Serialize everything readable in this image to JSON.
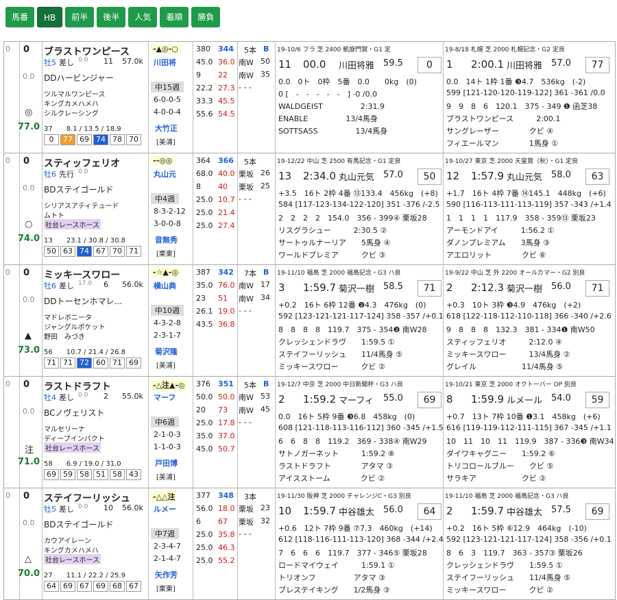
{
  "toolbar": [
    "馬番",
    "HB",
    "前半",
    "後半",
    "人気",
    "着順",
    "勝負"
  ],
  "horses": [
    {
      "no": "0",
      "pop": "0",
      "name": "ブラストワンピース",
      "sex": "牡5",
      "style": "差し",
      "style_sub": "0.0",
      "w": "11",
      "win": "57.0k",
      "odds": "0.0",
      "sire": "DDハービンジャー",
      "dam": "ツルマルワンピース",
      "bms": "キングカメハメハ",
      "owner": "シルクレーシング",
      "owner_tag": false,
      "mark": "◎",
      "score": "77.0",
      "stats": "37　　8.1 / 13.5 / 18.9",
      "marks": "-▲◎-○",
      "jockey": "川田将",
      "weeks": "中15週",
      "rec1": "6-0-0-5",
      "rec2": "4-0-0-4",
      "trainer": "大竹正",
      "loc": "[美浦]",
      "sp": [
        "380",
        "344",
        "45.0",
        "36.0",
        "9",
        "22",
        "22.2",
        "27.3",
        "33.3",
        "45.5",
        "55.6",
        "54.5"
      ],
      "cnt": "5本",
      "grade": "B",
      "cs": [
        [
          "南W",
          "50"
        ],
        [
          "南W",
          "35"
        ],
        [
          "- - -",
          ""
        ]
      ],
      "boxes": [
        "0",
        "77",
        "69",
        "74",
        "78",
        "70"
      ],
      "hl": [
        1,
        3
      ],
      "r1": {
        "hd": "19-10/6 フラ 芝 2400 凱旋門賞・G1 定",
        "rank": "11",
        "time": "00.0",
        "jockey": "川田将雅",
        "wt": "59.5",
        "num": "0",
        "lines": [
          "0.0　0ト　0枠　5番　0.0　　0kg　(0)",
          "0 [　-　-　-　-　-　] -0 /0.0",
          "WALDGEIST　　　　　2:31.9",
          "ENABLE　　　　　13/4馬身",
          "SOTTSASS　　　　　13/4馬身"
        ]
      },
      "r2": {
        "hd": "19-8/18 札幌 芝 2000 札幌記念・G2 定良",
        "rank": "1",
        "time": "2:00.1",
        "jockey": "川田将雅",
        "wt": "57.0",
        "num": "77",
        "lines": [
          "0.0　14ト 1枠 1番 ❸4.7　536kg　(-2)",
          "599 [121-120-120-119-122] 361 -361 /0.0",
          "9　9　8　6　120.1　375 - 349 ❶ 函芝38",
          "ブラストワンピース　　　2:00.1",
          "サングレーザー　　　　クビ ④",
          "フィエールマン　　　　1馬身 ①"
        ]
      }
    },
    {
      "no": "0",
      "pop": "0",
      "name": "スティッフェリオ",
      "sex": "牡6",
      "style": "先行",
      "style_sub": "0.0",
      "w": "",
      "win": "",
      "odds": "0.0",
      "sire": "BDステイゴールド",
      "dam": "シリアスアティテュード",
      "bms": "ムトト",
      "owner": "社台レースホース",
      "owner_tag": true,
      "mark": "○",
      "score": "74.0",
      "stats": "13　　23.1 / 30.8 / 30.8",
      "marks": "--◎◎",
      "jockey": "丸山元",
      "weeks": "中4週",
      "rec1": "8-3-2-12",
      "rec2": "3-0-0-8",
      "trainer": "音無秀",
      "loc": "[栗東]",
      "sp": [
        "364",
        "366",
        "68.0",
        "40.0",
        "8",
        "40",
        "25.0",
        "10.7",
        "25.0",
        "21.4",
        "25.0",
        "27.4"
      ],
      "cnt": "5本",
      "grade": "",
      "cs": [
        [
          "栗坂",
          "26"
        ],
        [
          "栗坂",
          "25"
        ],
        [
          "- - -",
          ""
        ]
      ],
      "boxes": [
        "50",
        "63",
        "74",
        "67",
        "70",
        "71"
      ],
      "hl": [
        2
      ],
      "r1": {
        "hd": "19-12/22 中山 芝 2500 有馬記念・G1 定良",
        "rank": "13",
        "time": "2:34.0",
        "jockey": "丸山元気",
        "wt": "57.0",
        "num": "50",
        "lines": [
          "+3.5　16ト 2枠 4番 ⑬133.4　456kg　(+8)",
          "584 [117-123-134-122-120] 351 -376 /-2.5",
          "2　2　2　2　154.0　356 - 399④ 栗坂28",
          "リスグラシュー　　　2:30.5 ②",
          "サートゥルナーリア　　5馬身 ④",
          "ワールドプレミア　　　クビ ③"
        ]
      },
      "r2": {
        "hd": "19-10/27 東京 芝 2000 天皇賞（秋）・G1 定良",
        "rank": "12",
        "time": "1:57.9",
        "jockey": "丸山元気",
        "wt": "58.0",
        "num": "63",
        "lines": [
          "+1.7　16ト 4枠 7番 ⑭145.1　448kg　(+6)",
          "590 [116-113-111-113-119] 357 -343 /+1.4",
          "1　1　1　1　117.9　358 - 359⑬ 栗坂23",
          "アーモンドアイ　　　1:56.2 ①",
          "ダノンプレミアム　　3馬身 ③",
          "アエロリット　　　　クビ ⑥"
        ]
      }
    },
    {
      "no": "0",
      "pop": "0",
      "name": "ミッキースワロー",
      "sex": "牡6",
      "style": "差し",
      "style_sub": "17.0",
      "w": "6",
      "win": "56.0k",
      "odds": "0.0",
      "sire": "DDトーセンホマレ…",
      "dam": "マドレボニータ",
      "bms": "ジャングルポケット",
      "owner": "野田　みづき",
      "owner_tag": false,
      "mark": "▲",
      "score": "73.0",
      "stats": "56　　10.7 / 21.4 / 26.8",
      "marks": "-☆▲-◎",
      "jockey": "横山典",
      "weeks": "中10週",
      "rec1": "4-3-2-8",
      "rec2": "2-3-1-7",
      "trainer": "菊沢隆",
      "loc": "[美浦]",
      "sp": [
        "387",
        "342",
        "35.0",
        "76.0",
        "23",
        "51",
        "26.1",
        "19.0",
        "43.5",
        "36.8",
        "",
        ""
      ],
      "cnt": "7本",
      "grade": "B",
      "cs": [
        [
          "南W",
          "17"
        ],
        [
          "南W",
          "34"
        ],
        [
          "- - -",
          ""
        ]
      ],
      "boxes": [
        "71",
        "71",
        "72",
        "60",
        "71",
        "69"
      ],
      "hl": [
        2
      ],
      "r1": {
        "hd": "19-11/10 福島 芝 2000 福島記念・G3 ハ良",
        "rank": "3",
        "time": "1:59.7",
        "jockey": "菊沢一樹",
        "wt": "58.5",
        "num": "71",
        "lines": [
          "+0.2　16ト 6枠 12番 ❷4.3　476kg　(0)",
          "592 [123-121-121-117-124] 358 -357 /+0.1",
          "8　8　8　8　119.7　375 - 354❷ 南W28",
          "クレッシェンドラヴ　　1:59.5 ①",
          "ステイフーリッシュ　　11/4馬身 ⑤",
          "ミッキースワロー　　　クビ ②"
        ]
      },
      "r2": {
        "hd": "19-9/22 中山 芝 外 2200 オールカマー・G2 別良",
        "rank": "2",
        "time": "2:12.3",
        "jockey": "菊沢一樹",
        "wt": "56.0",
        "num": "71",
        "lines": [
          "+0.3　10ト 3枠 ❸4.9　476kg　(+2)",
          "618 [122-118-112-110-118] 366 -340 /+2.6",
          "9　8　8　8　132.3　381 - 334❶ 南W50",
          "スティッフェリオ　　　2:12.0 ④",
          "ミッキースワロー　　　13/4馬身 ②",
          "グレイル　　　　　　11/4馬身 ⑤"
        ]
      }
    },
    {
      "no": "0",
      "pop": "0",
      "name": "ラストドラフト",
      "sex": "牡4",
      "style": "差し",
      "style_sub": "0.0",
      "w": "2",
      "win": "55.0k",
      "odds": "0.0",
      "sire": "BCノヴェリスト",
      "dam": "マルセリーナ",
      "bms": "ディープインパクト",
      "owner": "社台レースホース",
      "owner_tag": true,
      "mark": "注",
      "score": "71.0",
      "stats": "58　　6.9 / 19.0 / 31.0",
      "marks": "-△注▲-◎",
      "jockey": "マーフ",
      "weeks": "中6週",
      "rec1": "2-1-0-3",
      "rec2": "1-1-0-3",
      "trainer": "戸田博",
      "loc": "[美浦]",
      "sp": [
        "376",
        "351",
        "50.0",
        "50.0",
        "20",
        "73",
        "25.0",
        "17.8",
        "35.0",
        "37.0",
        "45.0",
        "50.7"
      ],
      "cnt": "5本",
      "grade": "B",
      "cs": [
        [
          "南W",
          "53"
        ],
        [
          "南W",
          "45"
        ],
        [
          "- - -",
          ""
        ]
      ],
      "boxes": [
        "69",
        "59",
        "58",
        "51",
        "58",
        "43"
      ],
      "hl": [],
      "r1": {
        "hd": "19-12/7 中京 芝 2000 中日新聞杯・G3 ハ良",
        "rank": "2",
        "time": "1:59.2",
        "jockey": "マーフィ",
        "wt": "55.0",
        "num": "69",
        "lines": [
          "0.0　16ト 5枠 9番 ❸6.8　458kg　(0)",
          "608 [121-118-113-116-112] 360 -345 /+1.5",
          "6　6　8　8　119.2　369 - 338④ 南W29",
          "サトノガーネット　　　1:59.2 ⑧",
          "ラストドラフト　　　　アタマ ③",
          "アイスストーム　　　　クビ ②"
        ]
      },
      "r2": {
        "hd": "19-10/21 東京 芝 2000 オクトーバー OP 別良",
        "rank": "8",
        "time": "1:59.9",
        "jockey": "ルメール",
        "wt": "54.0",
        "num": "59",
        "lines": [
          "+0.7　13ト 7枠 10番 ❶3.1　458kg　(+6)",
          "616 [119-119-112-111-115] 367 -345 /+1.1",
          "10　11　10　11　119.9　387 - 336❸ 南W34",
          "ダイワキャグニー　　1:59.2 ⑥",
          "トリコロールブルー　　クビ ⑤",
          "サラキア　　　　　　クビ ②"
        ]
      }
    },
    {
      "no": "0",
      "pop": "0",
      "name": "ステイフーリッシュ",
      "sex": "牡5",
      "style": "差し",
      "style_sub": "0.0",
      "w": "10",
      "win": "56.0k",
      "odds": "0.0",
      "sire": "BDステイゴールド",
      "dam": "カウアイレーン",
      "bms": "キングカメハメハ",
      "owner": "社台レースホース",
      "owner_tag": true,
      "mark": "△",
      "score": "70.0",
      "stats": "27　　11.1 / 22.2 / 25.9",
      "marks": "-△△注",
      "jockey": "ルメー",
      "weeks": "中7週",
      "rec1": "2-3-4-7",
      "rec2": "2-1-4-7",
      "trainer": "矢作芳",
      "loc": "[栗東]",
      "sp": [
        "377",
        "348",
        "56.0",
        "18.0",
        "6",
        "67",
        "25.0",
        "35.8",
        "25.0",
        "46.3",
        "25.0",
        "55.2"
      ],
      "cnt": "3本",
      "grade": "",
      "cs": [
        [
          "栗坂",
          "23"
        ],
        [
          "栗坂",
          "32"
        ],
        [
          "- - -",
          ""
        ]
      ],
      "boxes": [
        "64",
        "69",
        "67",
        "69",
        "68",
        "67"
      ],
      "hl": [],
      "r1": {
        "hd": "19-11/30 阪神 芝 2000 チャレンジC・G3 別良",
        "rank": "10",
        "time": "1:59.7",
        "jockey": "中谷雄太",
        "wt": "56.0",
        "num": "64",
        "lines": [
          "+0.6　12ト 7枠 9番 ⑦7.3　460kg　(+14)",
          "612 [118-116-111-113-120] 368 -344 /+2.4",
          "7　6　6　6　119.7　377 - 346⑤ 栗坂28",
          "ロードマイウェイ　　　1:59.1 ①",
          "トリオンフ　　　　　アタマ ③",
          "ブレステイキング　　1/2馬身 ③"
        ]
      },
      "r2": {
        "hd": "19-11/10 福島 芝 2000 福島記念・G3 ハ良",
        "rank": "2",
        "time": "1:59.7",
        "jockey": "中谷雄太",
        "wt": "57.5",
        "num": "69",
        "lines": [
          "+0.2　16ト 5枠 ⑥12.9　464kg　(-10)",
          "592 [123-121-121-117-124] 358 -356 /+0.1",
          "8　6　3　119.7　363 - 357③ 栗坂26",
          "クレッシェンドラヴ　　1:59.5 ①",
          "ステイフーリッシュ　　11/4馬身 ⑤",
          "ミッキースワロー　　　クビ ②"
        ]
      }
    }
  ]
}
